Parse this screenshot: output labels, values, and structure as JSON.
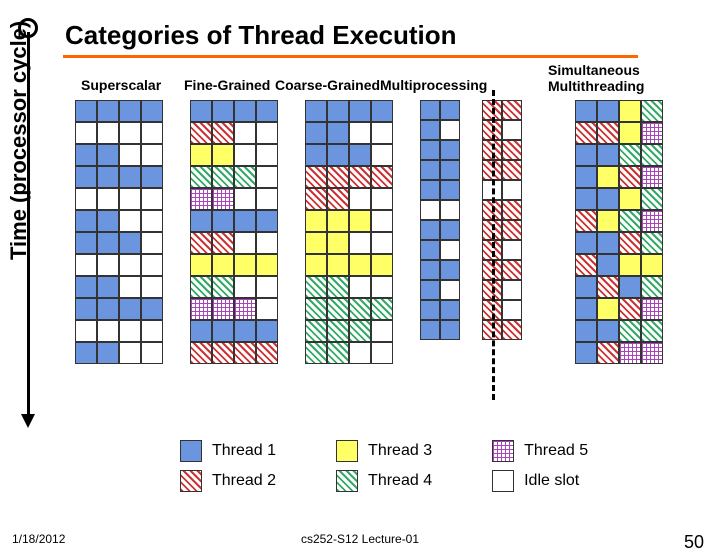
{
  "title": "Categories of Thread Execution",
  "ylabel": "Time (processor cycle)",
  "headers": [
    "Superscalar",
    "Fine-Grained",
    "Coarse-Grained",
    "Multiprocessing",
    "Simultaneous Multithreading"
  ],
  "legend": {
    "thread1": "Thread 1",
    "thread2": "Thread 2",
    "thread3": "Thread 3",
    "thread4": "Thread 4",
    "thread5": "Thread 5",
    "idle": "Idle slot"
  },
  "footer": {
    "date": "1/18/2012",
    "lecture": "cs252-S12 Lecture-01",
    "page": "50"
  },
  "chart_data": {
    "type": "table",
    "rows": 12,
    "cols": 4,
    "cell_values": "1=Thread1(blue) 2=Thread2(red-hatch) 3=Thread3(yellow) 4=Thread4(green-hatch) 5=Thread5(purple-grid) 0=Idle(white)",
    "columns": [
      {
        "name": "Superscalar",
        "grid": [
          [
            1,
            1,
            1,
            1
          ],
          [
            0,
            0,
            0,
            0
          ],
          [
            1,
            1,
            0,
            0
          ],
          [
            1,
            1,
            1,
            1
          ],
          [
            0,
            0,
            0,
            0
          ],
          [
            1,
            1,
            0,
            0
          ],
          [
            1,
            1,
            1,
            0
          ],
          [
            0,
            0,
            0,
            0
          ],
          [
            1,
            1,
            0,
            0
          ],
          [
            1,
            1,
            1,
            1
          ],
          [
            0,
            0,
            0,
            0
          ],
          [
            1,
            1,
            0,
            0
          ]
        ]
      },
      {
        "name": "Fine-Grained",
        "grid": [
          [
            1,
            1,
            1,
            1
          ],
          [
            2,
            2,
            0,
            0
          ],
          [
            3,
            3,
            0,
            0
          ],
          [
            4,
            4,
            4,
            0
          ],
          [
            5,
            5,
            0,
            0
          ],
          [
            1,
            1,
            1,
            1
          ],
          [
            2,
            2,
            0,
            0
          ],
          [
            3,
            3,
            3,
            3
          ],
          [
            4,
            4,
            0,
            0
          ],
          [
            5,
            5,
            5,
            0
          ],
          [
            1,
            1,
            1,
            1
          ],
          [
            2,
            2,
            2,
            2
          ]
        ]
      },
      {
        "name": "Coarse-Grained",
        "grid": [
          [
            1,
            1,
            1,
            1
          ],
          [
            1,
            1,
            0,
            0
          ],
          [
            1,
            1,
            1,
            0
          ],
          [
            2,
            2,
            2,
            2
          ],
          [
            2,
            2,
            0,
            0
          ],
          [
            3,
            3,
            3,
            0
          ],
          [
            3,
            3,
            0,
            0
          ],
          [
            3,
            3,
            3,
            3
          ],
          [
            4,
            4,
            0,
            0
          ],
          [
            4,
            4,
            4,
            4
          ],
          [
            4,
            4,
            4,
            0
          ],
          [
            4,
            4,
            0,
            0
          ]
        ]
      },
      {
        "name": "Multiprocessing",
        "split": true,
        "left": [
          [
            1,
            1
          ],
          [
            1,
            0
          ],
          [
            1,
            1
          ],
          [
            1,
            1
          ],
          [
            1,
            1
          ],
          [
            0,
            0
          ],
          [
            1,
            1
          ],
          [
            1,
            0
          ],
          [
            1,
            1
          ],
          [
            1,
            0
          ],
          [
            1,
            1
          ],
          [
            1,
            1
          ]
        ],
        "right": [
          [
            2,
            2
          ],
          [
            2,
            0
          ],
          [
            2,
            2
          ],
          [
            2,
            2
          ],
          [
            0,
            0
          ],
          [
            2,
            2
          ],
          [
            2,
            2
          ],
          [
            2,
            0
          ],
          [
            2,
            2
          ],
          [
            2,
            0
          ],
          [
            2,
            0
          ],
          [
            2,
            2
          ]
        ]
      },
      {
        "name": "Simultaneous Multithreading",
        "grid": [
          [
            1,
            1,
            3,
            4
          ],
          [
            2,
            2,
            3,
            5
          ],
          [
            1,
            1,
            4,
            4
          ],
          [
            1,
            3,
            2,
            5
          ],
          [
            1,
            1,
            3,
            4
          ],
          [
            2,
            3,
            4,
            5
          ],
          [
            1,
            1,
            2,
            4
          ],
          [
            2,
            1,
            3,
            3
          ],
          [
            1,
            2,
            1,
            4
          ],
          [
            1,
            3,
            2,
            5
          ],
          [
            1,
            1,
            4,
            4
          ],
          [
            1,
            2,
            5,
            5
          ]
        ]
      }
    ]
  }
}
